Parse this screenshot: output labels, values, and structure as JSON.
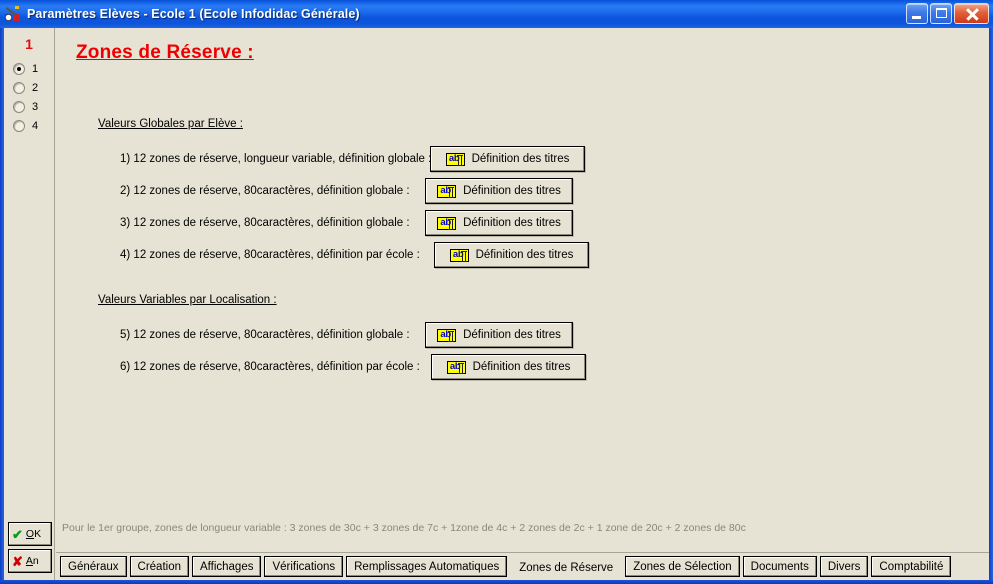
{
  "window": {
    "title": "Paramètres Elèves - Ecole 1 (Ecole Infodidac Générale)",
    "icon": "app-icon",
    "controls": {
      "minimize": "minimize-icon",
      "maximize": "maximize-icon",
      "close": "close-icon"
    }
  },
  "left_panel": {
    "number": "1",
    "radios": [
      {
        "label": "1",
        "checked": true
      },
      {
        "label": "2",
        "checked": false
      },
      {
        "label": "3",
        "checked": false
      },
      {
        "label": "4",
        "checked": false
      }
    ],
    "ok_button": {
      "label": "OK",
      "icon": "check-icon"
    },
    "cancel_button": {
      "label": "An",
      "icon": "cross-icon"
    }
  },
  "content": {
    "title": "Zones de Réserve :",
    "sections": [
      {
        "heading": "Valeurs Globales par Elève :",
        "rows": [
          {
            "label": "1) 12 zones de réserve, longueur variable, définition globale :",
            "button_label": "Définition des titres",
            "button_icon": "abl-icon"
          },
          {
            "label": "2) 12 zones de réserve, 80caractères, définition globale :",
            "button_label": "Définition des titres",
            "button_icon": "abl-icon"
          },
          {
            "label": "3) 12 zones de réserve, 80caractères, définition globale :",
            "button_label": "Définition des titres",
            "button_icon": "abl-icon"
          },
          {
            "label": "4) 12 zones de réserve, 80caractères, définition par école :",
            "button_label": "Définition des titres",
            "button_icon": "abl-icon"
          }
        ]
      },
      {
        "heading": "Valeurs Variables par Localisation :",
        "rows": [
          {
            "label": "5) 12 zones de réserve, 80caractères, définition globale :",
            "button_label": "Définition des titres",
            "button_icon": "abl-icon"
          },
          {
            "label": "6) 12 zones de réserve, 80caractères, définition par école :",
            "button_label": "Définition des titres",
            "button_icon": "abl-icon"
          }
        ]
      }
    ],
    "footer_note": "Pour le 1er groupe, zones de longueur variable : 3 zones de 30c + 3 zones de 7c + 1zone de 4c + 2 zones de 2c + 1 zone de 20c + 2 zones de 80c"
  },
  "tabs": [
    {
      "label": "Généraux",
      "active": false
    },
    {
      "label": "Création",
      "active": false
    },
    {
      "label": "Affichages",
      "active": false
    },
    {
      "label": "Vérifications",
      "active": false
    },
    {
      "label": "Remplissages Automatiques",
      "active": false
    },
    {
      "label": "Zones de Réserve",
      "active": true
    },
    {
      "label": "Zones de Sélection",
      "active": false
    },
    {
      "label": "Documents",
      "active": false
    },
    {
      "label": "Divers",
      "active": false
    },
    {
      "label": "Comptabilité",
      "active": false
    }
  ],
  "colors": {
    "title_bar": "#1161e8",
    "window_border": "#0a40c8",
    "client_bg": "#e6e3d4",
    "accent_red": "#ee0000",
    "footer_text": "#8a8878",
    "icon_yellow": "#ffff00",
    "icon_blue": "#0000cc"
  },
  "layout": {
    "section_tops": [
      90,
      266
    ],
    "row_tops": [
      118,
      150,
      182,
      214,
      294,
      326
    ],
    "button_lefts": [
      426,
      421,
      421,
      430,
      421,
      427
    ],
    "button_widths": [
      155,
      148,
      148,
      155,
      148,
      155
    ]
  }
}
